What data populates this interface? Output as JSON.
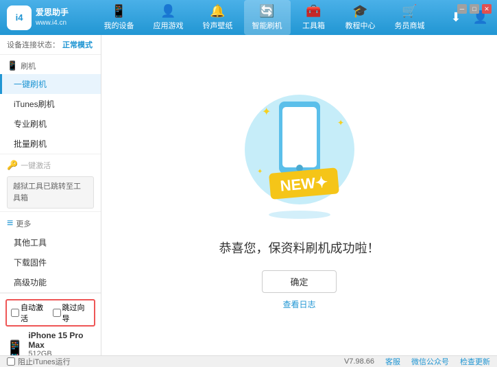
{
  "header": {
    "logo_text_line1": "爱思助手",
    "logo_text_line2": "www.i4.cn",
    "nav": [
      {
        "id": "my-device",
        "icon": "📱",
        "label": "我的设备"
      },
      {
        "id": "app-game",
        "icon": "👤",
        "label": "应用游戏"
      },
      {
        "id": "ringtone",
        "icon": "🔔",
        "label": "铃声壁纸"
      },
      {
        "id": "smart-flash",
        "icon": "🔄",
        "label": "智能刷机",
        "active": true
      },
      {
        "id": "toolbox",
        "icon": "🧰",
        "label": "工具箱"
      },
      {
        "id": "tutorial",
        "icon": "🎓",
        "label": "教程中心"
      },
      {
        "id": "service",
        "icon": "🛒",
        "label": "务员商城"
      }
    ],
    "download_icon": "⬇",
    "user_icon": "👤"
  },
  "sidebar": {
    "status_label": "设备连接状态：",
    "status_mode": "正常模式",
    "sections": [
      {
        "id": "flash",
        "header_icon": "📱",
        "header_label": "刷机",
        "items": [
          {
            "id": "onekey-flash",
            "label": "一键刷机",
            "active": true
          },
          {
            "id": "itunes-flash",
            "label": "iTunes刷机"
          },
          {
            "id": "pro-flash",
            "label": "专业刷机"
          },
          {
            "id": "batch-flash",
            "label": "批量刷机"
          }
        ]
      },
      {
        "id": "onekey-activate",
        "header_icon": "🔑",
        "header_label": "一键激活",
        "disabled": true,
        "notice": "越狱工具已跳转至工具箱"
      },
      {
        "id": "more",
        "header_icon": "≡",
        "header_label": "更多",
        "items": [
          {
            "id": "other-tools",
            "label": "其他工具"
          },
          {
            "id": "download-firmware",
            "label": "下载固件"
          },
          {
            "id": "advanced",
            "label": "高级功能"
          }
        ]
      }
    ]
  },
  "content": {
    "success_text": "恭喜您，保资料刷机成功啦！",
    "confirm_button": "确定",
    "log_link": "查看日志"
  },
  "device_bar": {
    "checkbox1_label": "自动激活",
    "checkbox2_label": "跳过向导",
    "device_name": "iPhone 15 Pro Max",
    "device_storage": "512GB",
    "device_type": "iPhone"
  },
  "footer": {
    "itunes_label": "阻止iTunes运行",
    "version": "V7.98.66",
    "links": [
      "客服",
      "微信公众号",
      "检查更新"
    ]
  }
}
